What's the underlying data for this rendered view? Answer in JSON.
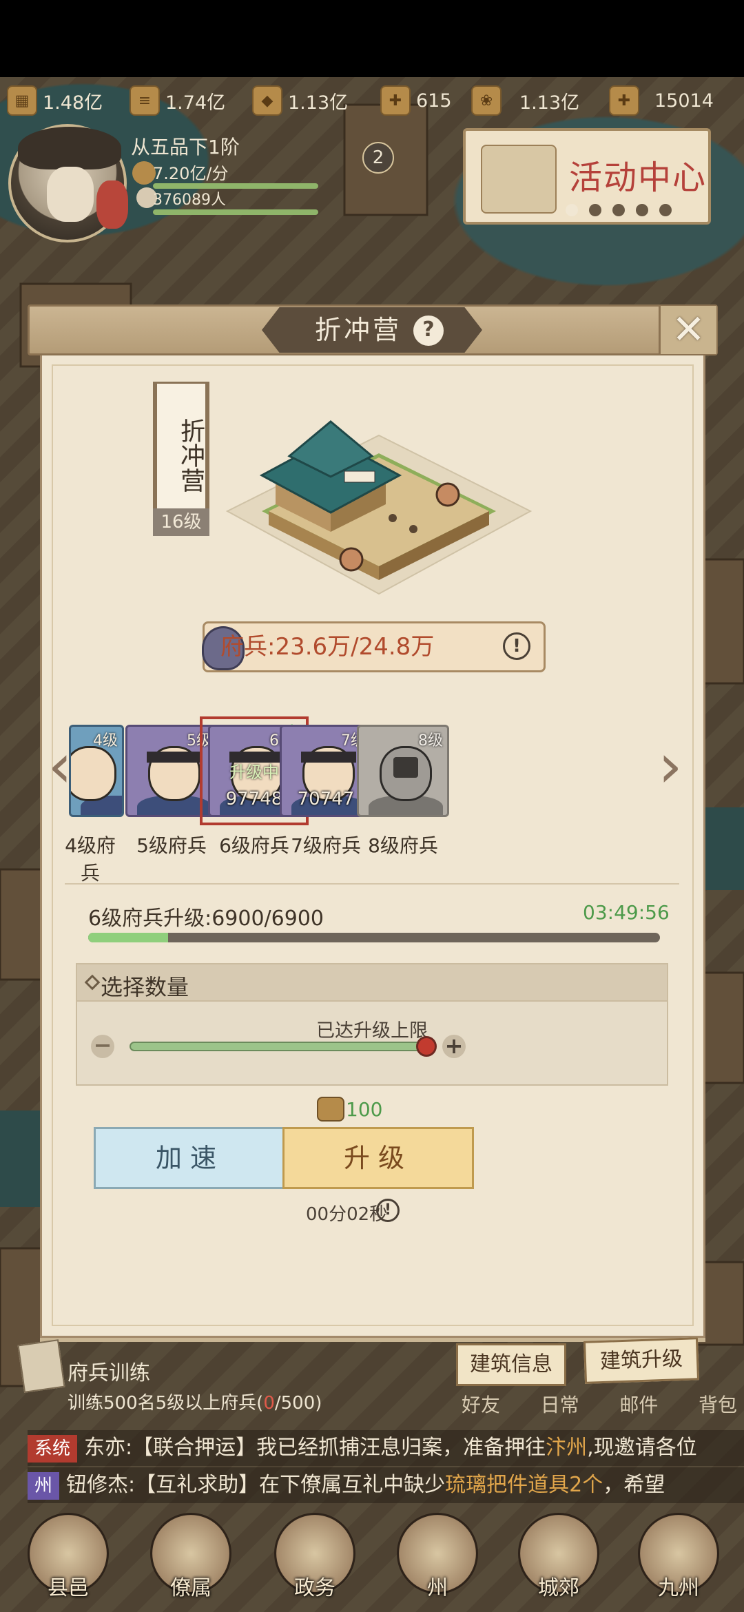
{
  "resources": [
    {
      "icon": "wood-icon",
      "value": "1.48亿"
    },
    {
      "icon": "log-icon",
      "value": "1.74亿"
    },
    {
      "icon": "ore-icon",
      "value": "1.13亿"
    },
    {
      "icon": "lantern-icon",
      "value": "615"
    },
    {
      "icon": "grain-icon",
      "value": "1.13亿"
    },
    {
      "icon": "ingot-icon",
      "value": "15014"
    }
  ],
  "player": {
    "rank": "从五品下1阶",
    "income": "7.20亿/分",
    "population": "376089人",
    "badge": "2"
  },
  "event_center": {
    "title": "活动中心",
    "active_dot": 0,
    "dot_count": 5
  },
  "modal": {
    "title": "折冲营",
    "building_name": "折冲营",
    "building_level": "16级",
    "troops_label": "府兵:23.6万/24.8万",
    "cards": [
      {
        "level": "4级",
        "label": "4级府兵",
        "count": "",
        "status": "",
        "style": "blue"
      },
      {
        "level": "5级",
        "label": "5级府兵",
        "count": "",
        "status": "",
        "style": "purple"
      },
      {
        "level": "6级",
        "label": "6级府兵",
        "count": "97748",
        "status": "升级中",
        "style": "purple"
      },
      {
        "level": "7级",
        "label": "7级府兵",
        "count": "70747",
        "status": "",
        "style": "purple"
      },
      {
        "level": "8级",
        "label": "8级府兵",
        "count": "",
        "status": "",
        "style": "locked"
      }
    ],
    "upgrade_progress_label": "6级府兵升级:6900/6900",
    "upgrade_timer": "03:49:56",
    "upgrade_progress_fraction": 0.14,
    "quantity_title": "选择数量",
    "limit_text": "已达升级上限",
    "slider_fraction": 1.0,
    "cost_value": "100",
    "speed_button": "加速",
    "upgrade_button": "升级",
    "duration": "00分02秒"
  },
  "bottom": {
    "task_title": "府兵训练",
    "task_desc_prefix": "训练500名5级以上府兵(",
    "task_progress": "0",
    "task_desc_suffix": "/500)",
    "building_info": "建筑信息",
    "building_upgrade": "建筑升级",
    "menu_labels": [
      "好友",
      "日常",
      "邮件",
      "背包"
    ]
  },
  "chat": [
    {
      "channel": "系统",
      "channel_color": "#b23b2f",
      "text_a": "东亦:【联合押运】我已经抓捕汪息归案，准备押往",
      "highlight": "汴州",
      "text_b": ",现邀请各位"
    },
    {
      "channel": "州",
      "channel_color": "#6a56a8",
      "text_a": "钮修杰:【互礼求助】在下僚属互礼中缺少",
      "highlight": "琉璃把件道具2个",
      "text_b": "，希望"
    }
  ],
  "nav": [
    "县邑",
    "僚属",
    "政务",
    "州",
    "城郊",
    "九州"
  ],
  "colors": {
    "accent_red": "#b23b2f",
    "progress_green": "#8fcf7c",
    "paper": "#f0e6d2"
  }
}
